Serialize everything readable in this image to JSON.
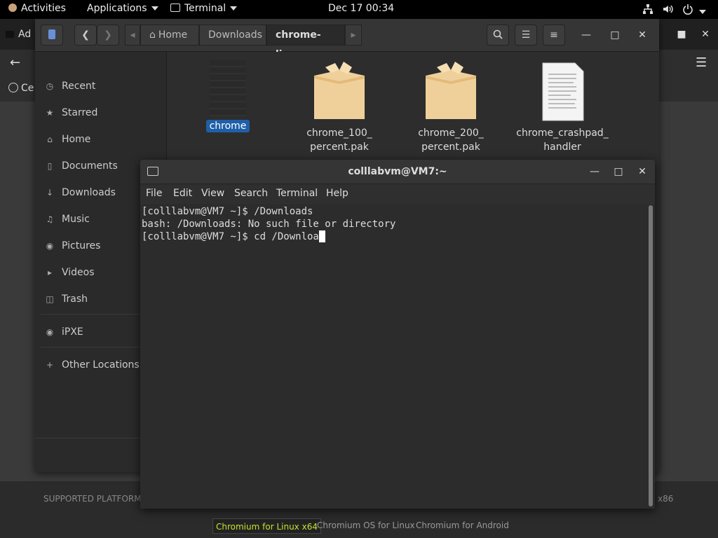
{
  "topbar": {
    "activities": "Activities",
    "applications": "Applications",
    "terminal": "Terminal",
    "clock": "Dec 17  00:34"
  },
  "browser": {
    "tab_label": "Ad",
    "bookmark_label": "Ce",
    "footer_left": "SUPPORTED PLATFORMS",
    "footer_right": "x86",
    "platforms": [
      "Chromium for Linux x64",
      "Chromium OS for Linux",
      "Chromium for Android"
    ],
    "accent": "#c6e030"
  },
  "files": {
    "breadcrumbs": [
      "Home",
      "Downloads",
      "chrome-linux"
    ],
    "sidebar": [
      {
        "label": "Recent",
        "icon": "clock-icon"
      },
      {
        "label": "Starred",
        "icon": "star-icon"
      },
      {
        "label": "Home",
        "icon": "home-icon"
      },
      {
        "label": "Documents",
        "icon": "document-icon"
      },
      {
        "label": "Downloads",
        "icon": "download-icon"
      },
      {
        "label": "Music",
        "icon": "music-icon"
      },
      {
        "label": "Pictures",
        "icon": "camera-icon"
      },
      {
        "label": "Videos",
        "icon": "video-icon"
      },
      {
        "label": "Trash",
        "icon": "trash-icon"
      },
      {
        "label": "iPXE",
        "icon": "drive-icon"
      },
      {
        "label": "Other Locations",
        "icon": "plus-icon"
      }
    ],
    "items": [
      {
        "line1": "chrome",
        "line2": "",
        "type": "executable",
        "selected": true
      },
      {
        "line1": "chrome_100_",
        "line2": "percent.pak",
        "type": "package",
        "selected": false
      },
      {
        "line1": "chrome_200_",
        "line2": "percent.pak",
        "type": "package",
        "selected": false
      },
      {
        "line1": "chrome_crashpad_",
        "line2": "handler",
        "type": "text",
        "selected": false
      }
    ],
    "selection_color": "#1f5fa8"
  },
  "terminal": {
    "title": "colllabvm@VM7:~",
    "menu": [
      "File",
      "Edit",
      "View",
      "Search",
      "Terminal",
      "Help"
    ],
    "lines": [
      "[colllabvm@VM7 ~]$ /Downloads",
      "bash: /Downloads: No such file or directory",
      "[colllabvm@VM7 ~]$ cd /Downloa"
    ]
  }
}
